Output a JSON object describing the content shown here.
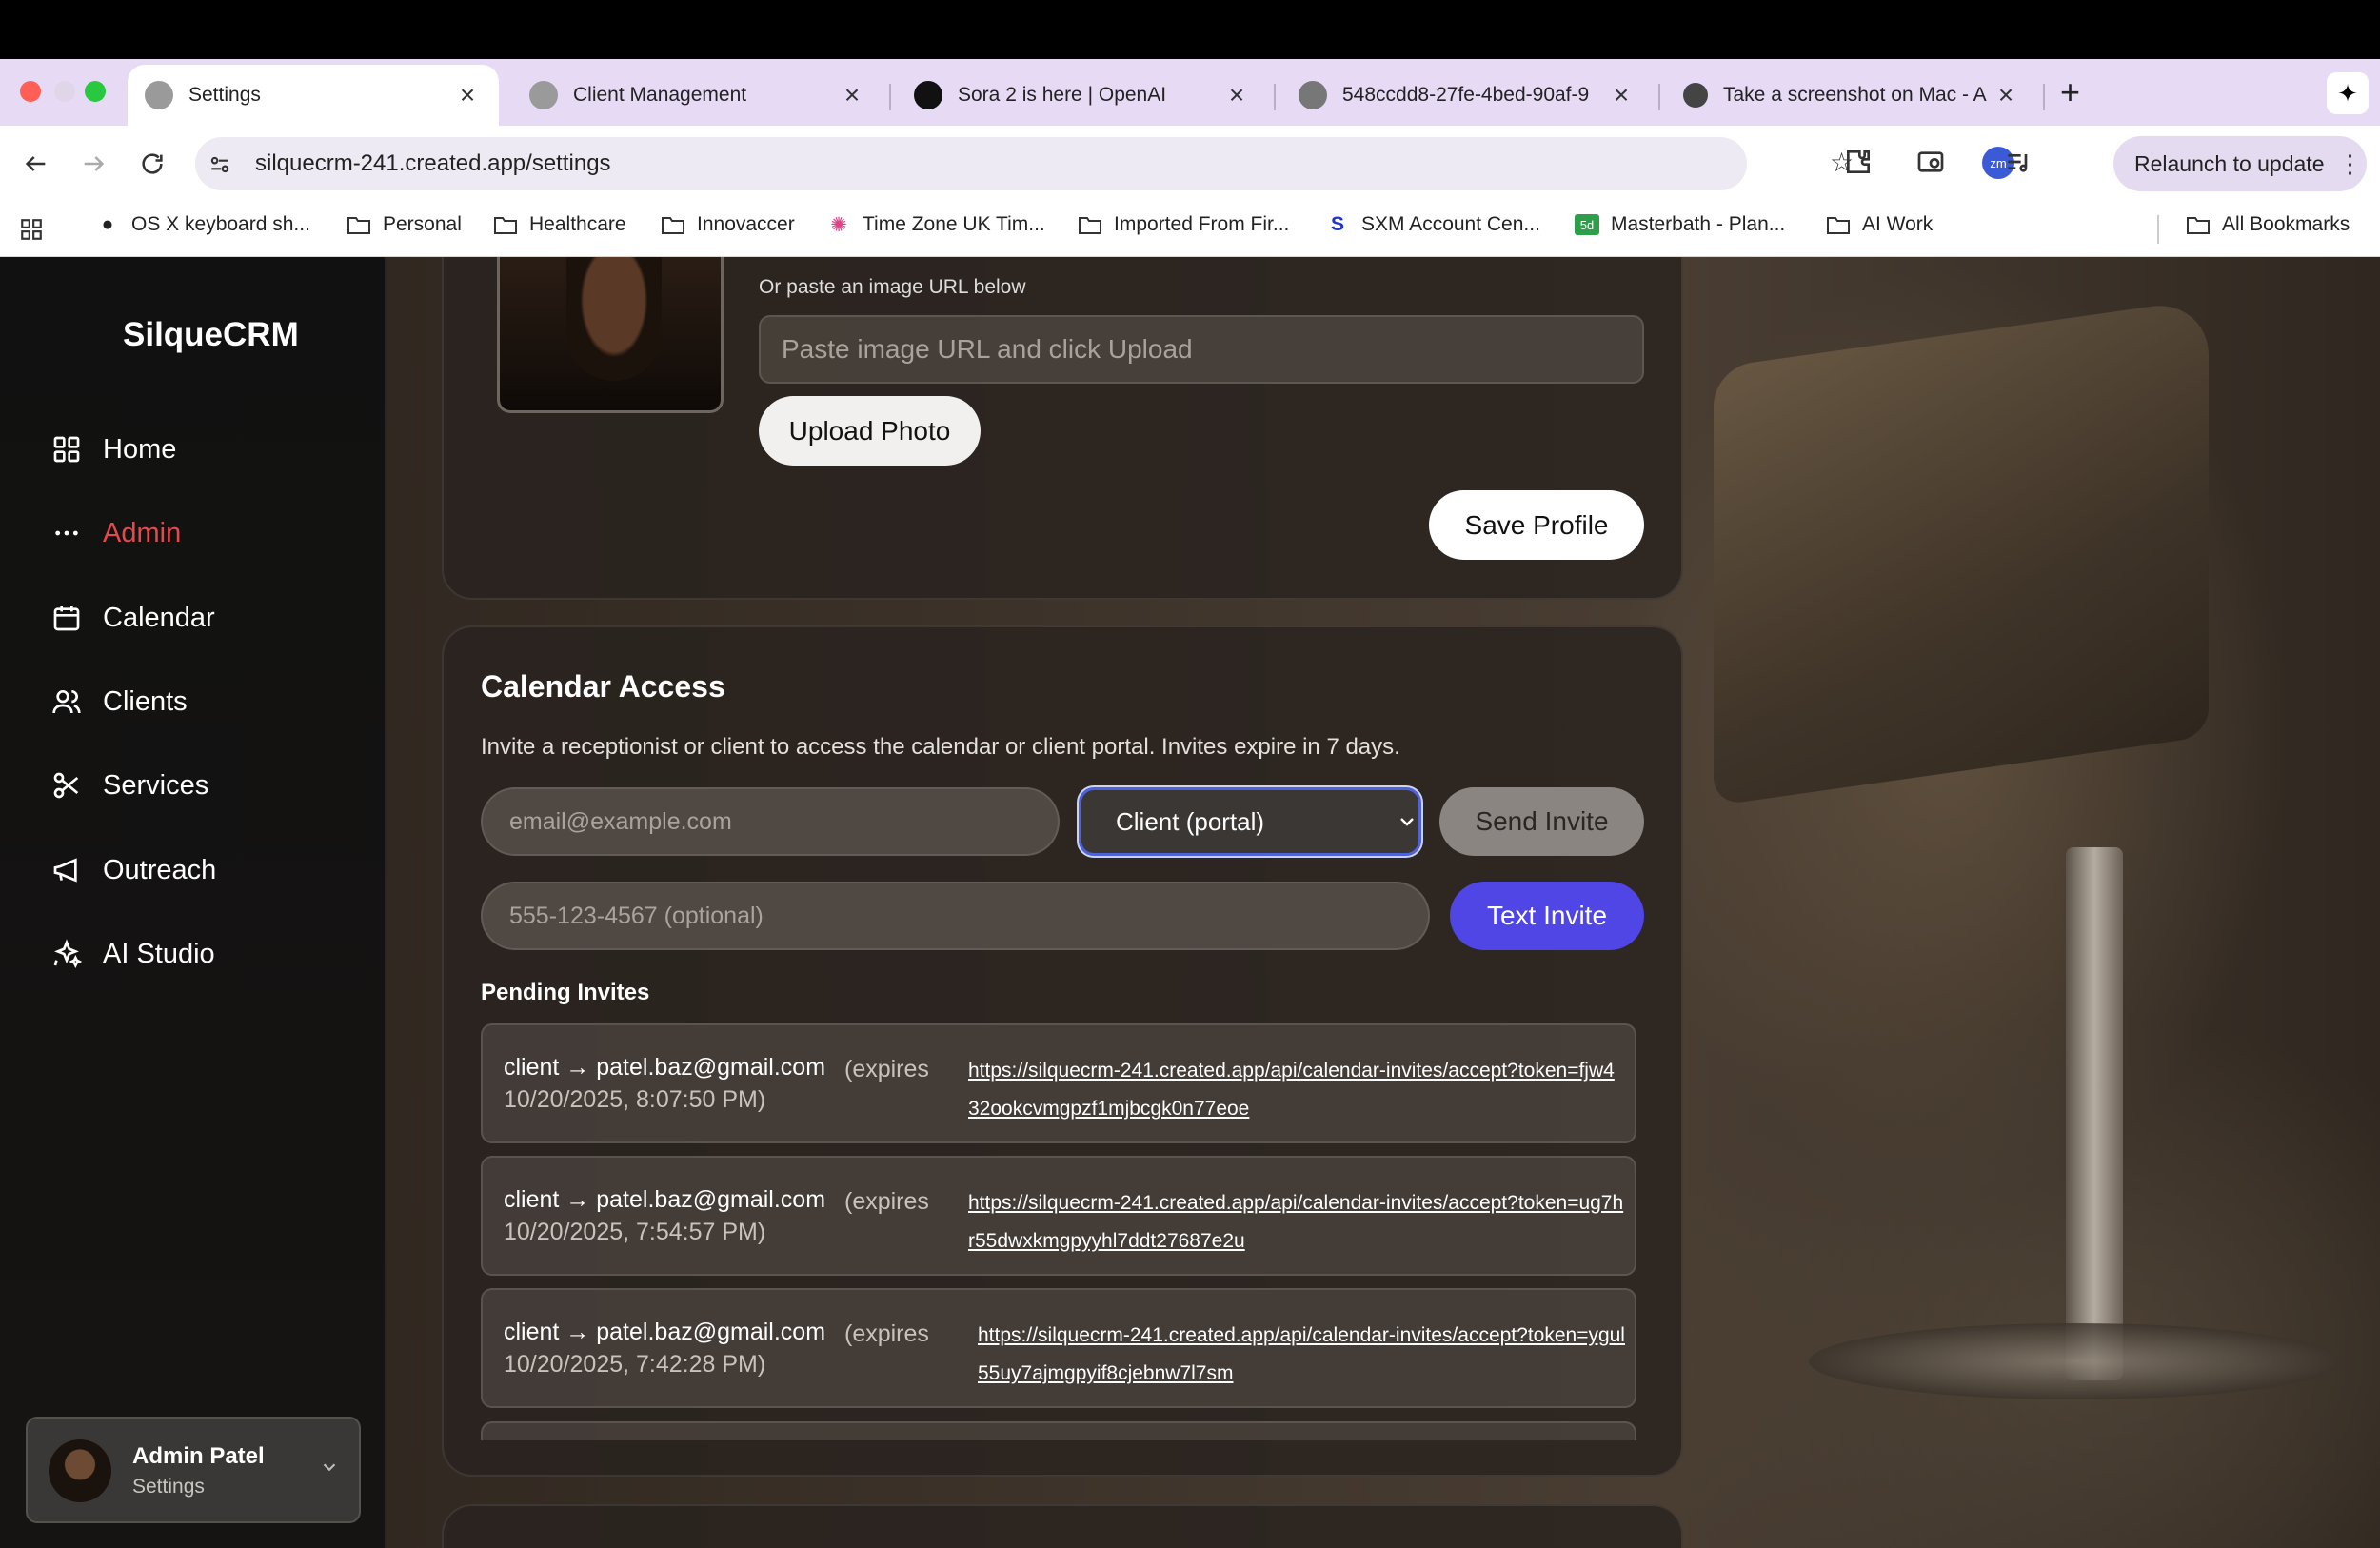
{
  "browser": {
    "tabs": [
      {
        "title": "Settings",
        "active": true
      },
      {
        "title": "Client Management",
        "active": false
      },
      {
        "title": "Sora 2 is here | OpenAI",
        "active": false
      },
      {
        "title": "548ccdd8-27fe-4bed-90af-9",
        "active": false
      },
      {
        "title": "Take a screenshot on Mac - A",
        "active": false
      }
    ],
    "url": "silquecrm-241.created.app/settings",
    "relaunch_label": "Relaunch to update",
    "bookmarks": [
      "OS X keyboard sh...",
      "Personal",
      "Healthcare",
      "Innovaccer",
      "Time Zone UK Tim...",
      "Imported From Fir...",
      "SXM Account Cen...",
      "Masterbath - Plan...",
      "AI Work",
      "All Bookmarks"
    ]
  },
  "app": {
    "name": "SilqueCRM",
    "nav": [
      {
        "label": "Home",
        "icon": "grid-icon",
        "active": false
      },
      {
        "label": "Admin",
        "icon": "more-horizontal-icon",
        "active": true
      },
      {
        "label": "Calendar",
        "icon": "calendar-icon",
        "active": false
      },
      {
        "label": "Clients",
        "icon": "users-icon",
        "active": false
      },
      {
        "label": "Services",
        "icon": "scissors-icon",
        "active": false
      },
      {
        "label": "Outreach",
        "icon": "megaphone-icon",
        "active": false
      },
      {
        "label": "AI Studio",
        "icon": "sparkles-icon",
        "active": false
      }
    ],
    "user": {
      "name": "Admin Patel",
      "role": "Settings"
    }
  },
  "profile": {
    "paste_label": "Or paste an image URL below",
    "url_placeholder": "Paste image URL and click Upload",
    "upload_label": "Upload Photo",
    "save_label": "Save Profile"
  },
  "calendar_access": {
    "title": "Calendar Access",
    "description": "Invite a receptionist or client to access the calendar or client portal. Invites expire in 7 days.",
    "email_placeholder": "email@example.com",
    "role_selected": "Client (portal)",
    "send_label": "Send Invite",
    "phone_placeholder": "555-123-4567 (optional)",
    "text_label": "Text Invite",
    "pending_title": "Pending Invites",
    "invites": [
      {
        "who": "client → patel.baz@gmail.com",
        "expires_prefix": "(expires",
        "expires_rest": "10/20/2025, 8:07:50 PM)",
        "link": "https://silquecrm-241.created.app/api/calendar-invites/accept?token=fjw432ookcvmgpzf1mjbcgk0n77eoe"
      },
      {
        "who": "client → patel.baz@gmail.com",
        "expires_prefix": "(expires",
        "expires_rest": "10/20/2025, 7:54:57 PM)",
        "link": "https://silquecrm-241.created.app/api/calendar-invites/accept?token=ug7hr55dwxkmgpyyhl7ddt27687e2u"
      },
      {
        "who": "client → patel.baz@gmail.com",
        "expires_prefix": "(expires",
        "expires_rest": "10/20/2025, 7:42:28 PM)",
        "link": "https://silquecrm-241.created.app/api/calendar-invites/accept?token=ygul55uy7ajmgpyif8cjebnw7l7sm"
      }
    ]
  },
  "colors": {
    "accent": "#4f46e5",
    "active_nav": "#e5484d"
  }
}
